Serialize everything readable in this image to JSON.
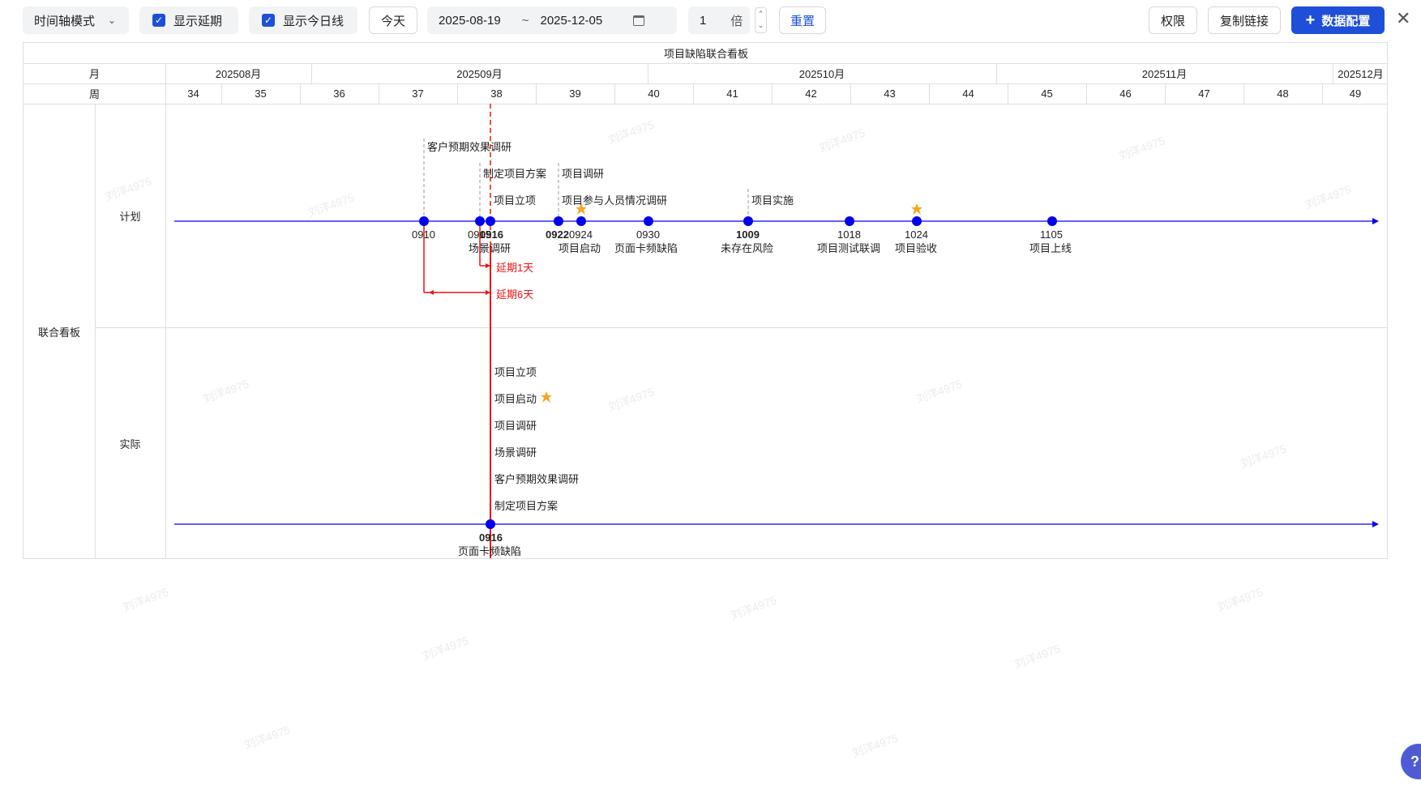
{
  "toolbar": {
    "mode_label": "时间轴模式",
    "show_delay_label": "显示延期",
    "show_today_label": "显示今日线",
    "today_button": "今天",
    "date_start": "2025-08-19",
    "date_sep": "~",
    "date_end": "2025-12-05",
    "zoom_value": "1",
    "zoom_unit": "倍",
    "reset_button": "重置",
    "permission_button": "权限",
    "copy_link_button": "复制链接",
    "data_config_button": "数据配置"
  },
  "board": {
    "title": "项目缺陷联合看板",
    "month_header": "月",
    "week_header": "周",
    "group_label": "联合看板",
    "row_plan_label": "计划",
    "row_actual_label": "实际",
    "months": [
      "202508月",
      "202509月",
      "202510月",
      "202511月",
      "202512月"
    ],
    "weeks": [
      "34",
      "35",
      "36",
      "37",
      "38",
      "39",
      "40",
      "41",
      "42",
      "43",
      "44",
      "45",
      "46",
      "47",
      "48",
      "49"
    ]
  },
  "plan": {
    "nodes": [
      {
        "date": "0910",
        "caption": ""
      },
      {
        "date": "0915",
        "caption": "场景调研"
      },
      {
        "date": "0916",
        "caption": ""
      },
      {
        "date": "0922",
        "caption": ""
      },
      {
        "date": "0924",
        "caption": "项目启动"
      },
      {
        "date": "0930",
        "caption": "页面卡频缺陷"
      },
      {
        "date": "1009",
        "caption": "未存在风险"
      },
      {
        "date": "1018",
        "caption": "项目测试联调"
      },
      {
        "date": "1024",
        "caption": "项目验收"
      },
      {
        "date": "1105",
        "caption": "项目上线"
      }
    ],
    "callouts": [
      "客户预期效果调研",
      "制定项目方案",
      "项目调研",
      "项目立项",
      "项目参与人员情况调研",
      "项目实施"
    ],
    "delays": [
      "延期1天",
      "延期6天"
    ]
  },
  "actual": {
    "node_date": "0916",
    "node_caption": "页面卡频缺陷",
    "stack": [
      "项目立项",
      "项目启动",
      "项目调研",
      "场景调研",
      "客户预期效果调研",
      "制定项目方案"
    ]
  },
  "watermark": "刘洋4975",
  "colors": {
    "primary": "#1f4fd8",
    "timeline": "#0000ee",
    "today": "#ee1111",
    "star": "#f5a623"
  }
}
